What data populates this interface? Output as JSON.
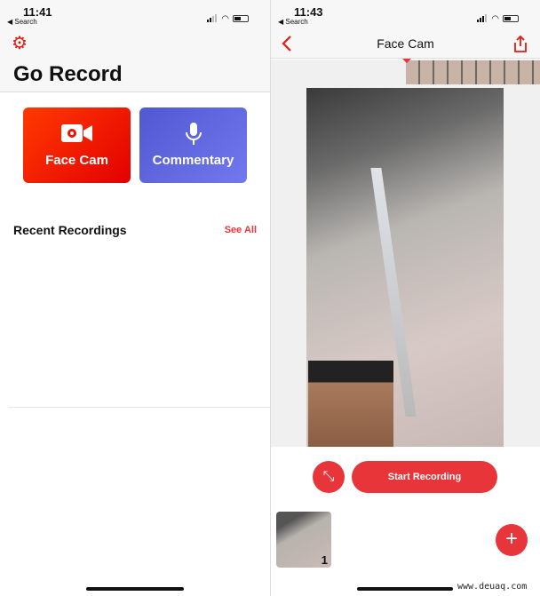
{
  "left": {
    "status": {
      "time": "11:41",
      "back": "◀ Search"
    },
    "title": "Go Record",
    "buttons": [
      {
        "label": "Face Cam",
        "icon": "video-camera-icon"
      },
      {
        "label": "Commentary",
        "icon": "microphone-icon"
      }
    ],
    "recent": {
      "heading": "Recent Recordings",
      "see_all": "See All"
    }
  },
  "right": {
    "status": {
      "time": "11:43",
      "back": "◀ Search"
    },
    "nav_title": "Face Cam",
    "start_label": "Start Recording",
    "clip_count": "1"
  },
  "colors": {
    "accent": "#e8353a",
    "facecam": "#f01d00",
    "commentary": "#5c63d8"
  },
  "watermark": "www.deuaq.com"
}
